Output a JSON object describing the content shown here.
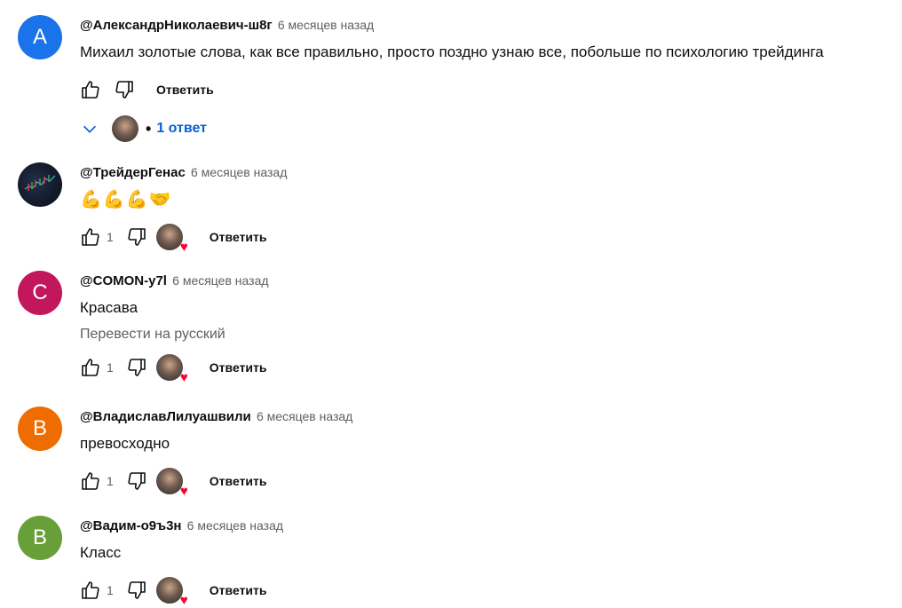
{
  "comments": [
    {
      "avatar_letter": "A",
      "avatar_color": "#1a73e8",
      "author": "@АлександрНиколаевич-ш8г",
      "time": "6 месяцев назад",
      "text": "Михаил золотые слова, как все правильно, просто поздно узнаю все, побольше по психологию трейдинга",
      "reply_label": "Ответить",
      "replies_label": "1 ответ"
    },
    {
      "author": "@ТрейдерГенас",
      "time": "6 месяцев назад",
      "text": "💪💪💪🤝",
      "likes": "1",
      "reply_label": "Ответить"
    },
    {
      "avatar_letter": "C",
      "avatar_color": "#c2185b",
      "author": "@COMON-y7l",
      "time": "6 месяцев назад",
      "text": "Красава",
      "translate_label": "Перевести на русский",
      "likes": "1",
      "reply_label": "Ответить"
    },
    {
      "avatar_letter": "B",
      "avatar_color": "#ef6c00",
      "author": "@ВладиславЛилуашвили",
      "time": "6 месяцев назад",
      "text": "превосходно",
      "likes": "1",
      "reply_label": "Ответить"
    },
    {
      "avatar_letter": "B",
      "avatar_color": "#689f38",
      "author": "@Вадим-о9ъ3н",
      "time": "6 месяцев назад",
      "text": "Класс",
      "likes": "1",
      "reply_label": "Ответить"
    }
  ],
  "icons": {
    "like": "thumbs-up-icon",
    "dislike": "thumbs-down-icon",
    "expand": "chevron-down-icon",
    "creator_heart": "heart-icon"
  },
  "colors": {
    "link_blue": "#065fd4",
    "heart_red": "#ff0033",
    "secondary_text": "#606060"
  }
}
